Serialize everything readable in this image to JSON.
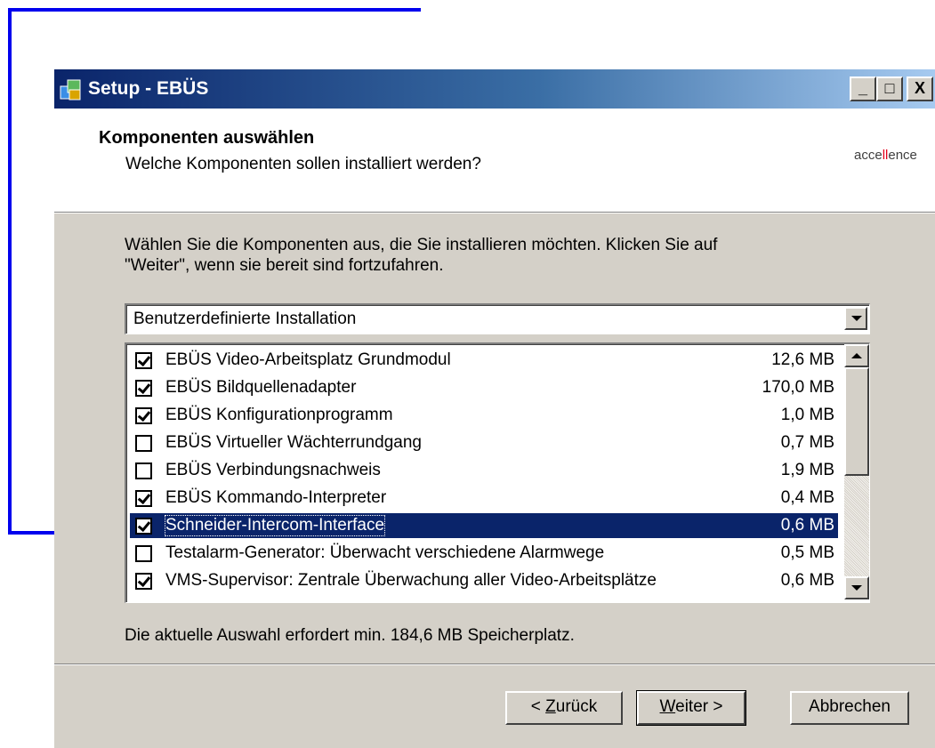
{
  "window": {
    "title": "Setup - EBÜS",
    "controls": {
      "minimize": "_",
      "maximize": "□",
      "close": "X"
    }
  },
  "header": {
    "title": "Komponenten auswählen",
    "subtitle": "Welche Komponenten sollen installiert werden?",
    "brand_a": "acce",
    "brand_b": "ll",
    "brand_c": "ence",
    "brand_accent": "#e2001a"
  },
  "body": {
    "description_line1": "Wählen Sie die Komponenten aus, die Sie installieren möchten. Klicken Sie auf",
    "description_line2": "\"Weiter\", wenn sie bereit sind fortzufahren.",
    "install_type": "Benutzerdefinierte Installation",
    "components": [
      {
        "label": "EBÜS Video-Arbeitsplatz Grundmodul",
        "size": "12,6 MB",
        "checked": true
      },
      {
        "label": "EBÜS Bildquellenadapter",
        "size": "170,0 MB",
        "checked": true
      },
      {
        "label": "EBÜS Konfigurationprogramm",
        "size": "1,0 MB",
        "checked": true
      },
      {
        "label": "EBÜS Virtueller Wächterrundgang",
        "size": "0,7 MB",
        "checked": false
      },
      {
        "label": "EBÜS Verbindungsnachweis",
        "size": "1,9 MB",
        "checked": false
      },
      {
        "label": "EBÜS Kommando-Interpreter",
        "size": "0,4 MB",
        "checked": true
      },
      {
        "label": "Schneider-Intercom-Interface",
        "size": "0,6 MB",
        "checked": true,
        "selected": true
      },
      {
        "label": "Testalarm-Generator: Überwacht verschiedene Alarmwege",
        "size": "0,5 MB",
        "checked": false
      },
      {
        "label": "VMS-Supervisor: Zentrale Überwachung aller Video-Arbeitsplätze",
        "size": "0,6 MB",
        "checked": true
      }
    ],
    "space_required": "Die aktuelle Auswahl erfordert min. 184,6 MB Speicherplatz."
  },
  "buttons": {
    "back_prefix": "< ",
    "back_accel": "Z",
    "back_rest": "urück",
    "next_accel": "W",
    "next_rest": "eiter >",
    "cancel": "Abbrechen"
  },
  "colors": {
    "selection": "#0a246a",
    "annotation_arrow": "#0000ee"
  }
}
